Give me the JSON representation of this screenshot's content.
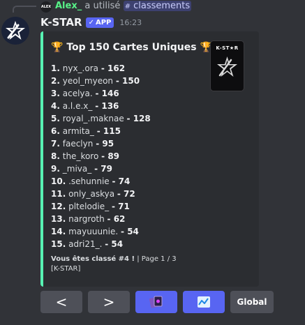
{
  "reply": {
    "avatar_text": "ALEX",
    "user": "Alex_",
    "verb": "a utilisé",
    "command_icon": "#",
    "command": "classements"
  },
  "message": {
    "author": "K-STAR",
    "badge": "APP",
    "badge_icon": "✓",
    "timestamp": "16:23",
    "avatar_icon": "star-logo-icon"
  },
  "embed": {
    "title_icon": "🏆",
    "title": "Top 150 Cartes Uniques",
    "accent_color": "#57f2b3",
    "thumbnail_label": "K-ST★R",
    "rankings": [
      {
        "rank": "1.",
        "name": "nyx_.ora",
        "score": "- 162"
      },
      {
        "rank": "2.",
        "name": "yeol_myeon",
        "score": "- 150"
      },
      {
        "rank": "3.",
        "name": "acelya.",
        "score": "- 146"
      },
      {
        "rank": "4.",
        "name": "a.l.e.x_",
        "score": "- 136"
      },
      {
        "rank": "5.",
        "name": "royal_.maknae",
        "score": "- 128"
      },
      {
        "rank": "6.",
        "name": "armita_",
        "score": "- 115"
      },
      {
        "rank": "7.",
        "name": "faeclyn",
        "score": "- 95"
      },
      {
        "rank": "8.",
        "name": "the_koro",
        "score": "- 89"
      },
      {
        "rank": "9.",
        "name": "_miva_",
        "score": "- 79"
      },
      {
        "rank": "10.",
        "name": ".sehunnie",
        "score": "- 74"
      },
      {
        "rank": "11.",
        "name": "only_askya",
        "score": "- 72"
      },
      {
        "rank": "12.",
        "name": "pltelodie_",
        "score": "- 71"
      },
      {
        "rank": "13.",
        "name": "nargroth",
        "score": "- 62"
      },
      {
        "rank": "14.",
        "name": "mayuuunie.",
        "score": "- 54"
      },
      {
        "rank": "15.",
        "name": "adri21_.",
        "score": "- 54"
      }
    ],
    "footer_bold": "Vous êtes classé #4 !",
    "footer_page": " | Page 1 / 3",
    "footer_brand": "[K-STAR]"
  },
  "buttons": {
    "prev_label": "<",
    "next_label": ">",
    "cards_icon": "cards-icon",
    "chart_icon": "chart-icon",
    "global_label": "Global"
  }
}
